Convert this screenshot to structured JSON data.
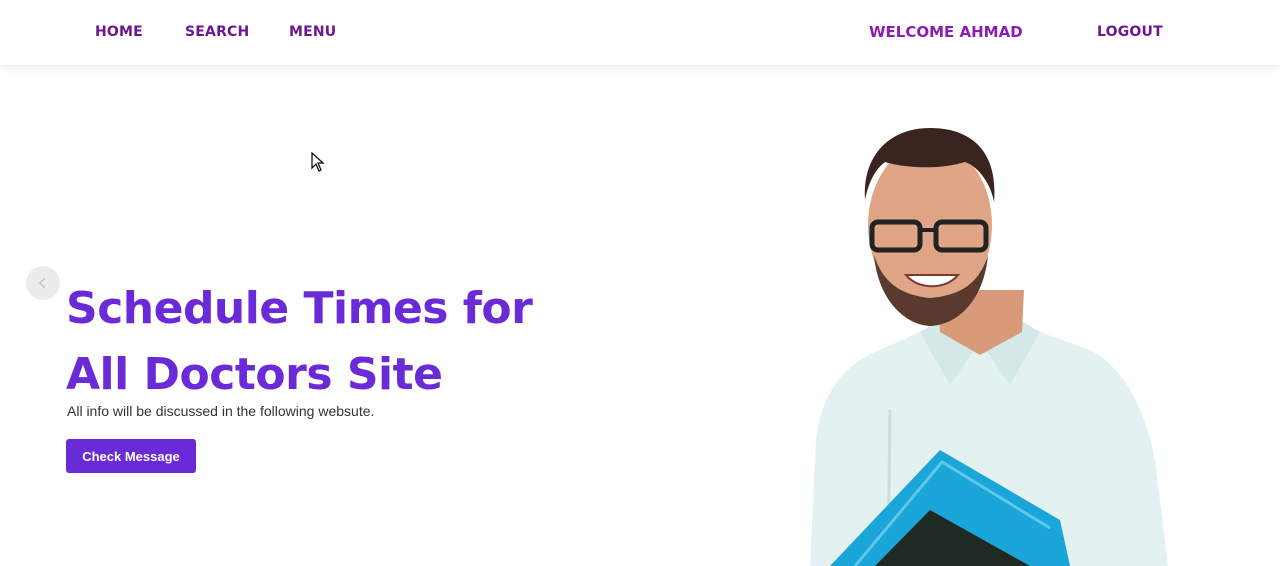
{
  "nav": {
    "home": "HOME",
    "search": "SEARCH",
    "menu": "MENU",
    "welcome": "WELCOME AHMAD",
    "logout": "LOGOUT"
  },
  "hero": {
    "title_line1": "Schedule Times for",
    "title_line2": "All Doctors Site",
    "subtitle": "All info will be discussed in the following websute.",
    "cta_label": "Check Message",
    "prev_icon": "chevron-left-icon",
    "image": "doctor-photo"
  },
  "colors": {
    "nav_text": "#6e1590",
    "welcome_text": "#8c1bb2",
    "accent": "#6a2ad8",
    "button_text": "#ffffff"
  }
}
